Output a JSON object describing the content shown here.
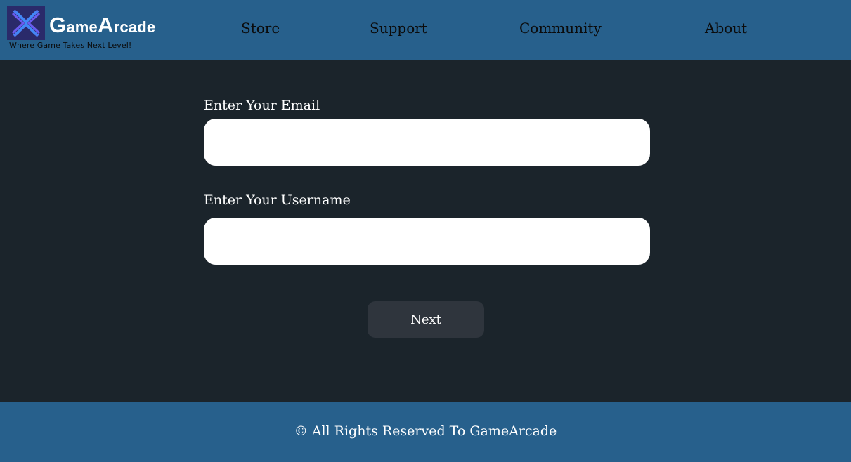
{
  "header": {
    "brand_first_letter": "G",
    "brand_part1": "ame",
    "brand_second_letter": "A",
    "brand_part2": "rcade",
    "tagline": "Where Game Takes Next Level!",
    "logo_icon": "x-logo-icon",
    "nav": [
      {
        "label": "Store"
      },
      {
        "label": "Support"
      },
      {
        "label": "Community"
      },
      {
        "label": "About"
      }
    ]
  },
  "form": {
    "email_label": "Enter Your Email",
    "email_value": "",
    "username_label": "Enter Your Username",
    "username_value": "",
    "next_label": "Next"
  },
  "footer": {
    "text": "© All Rights Reserved To GameArcade"
  },
  "colors": {
    "header_bg": "#27608c",
    "page_bg": "#1b242b",
    "button_bg": "#2f353d",
    "logo_bg": "#2a2a6a",
    "logo_accent": "#4a6cf0"
  }
}
